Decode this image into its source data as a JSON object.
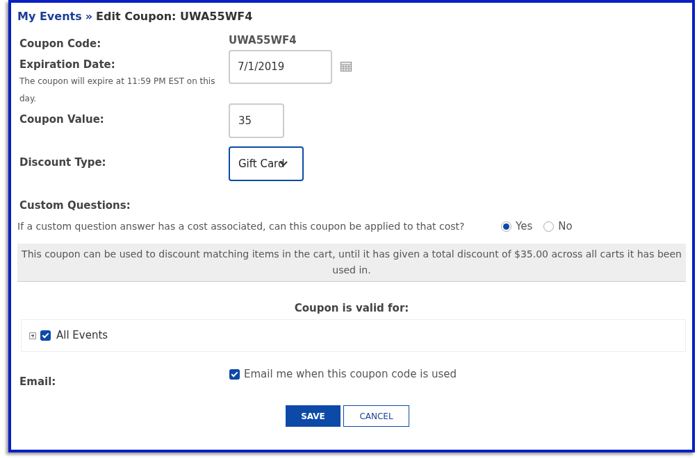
{
  "breadcrumb": {
    "link": "My Events",
    "separator": "»",
    "title": "Edit Coupon: UWA55WF4"
  },
  "coupon_code": {
    "label": "Coupon Code:",
    "value": "UWA55WF4"
  },
  "expiration": {
    "label": "Expiration Date:",
    "note": "The coupon will expire at 11:59 PM EST on this day.",
    "value": "7/1/2019"
  },
  "coupon_value": {
    "label": "Coupon Value:",
    "value": "35"
  },
  "discount_type": {
    "label": "Discount Type:",
    "value": "Gift Card"
  },
  "custom_questions": {
    "label": "Custom Questions:",
    "question": "If a custom question answer has a cost associated, can this coupon be applied to that cost?",
    "options": [
      {
        "label": "Yes",
        "selected": true
      },
      {
        "label": "No",
        "selected": false
      }
    ]
  },
  "notice": "This coupon can be used to discount matching items in the cart, until it has given a total discount of $35.00 across all carts it has been used in.",
  "valid_for": {
    "heading": "Coupon is valid for:",
    "items": [
      {
        "label": "All Events",
        "checked": true,
        "expanded": false
      }
    ]
  },
  "email": {
    "label": "Email:",
    "option": {
      "label": "Email me when this coupon code is used",
      "checked": true
    }
  },
  "buttons": [
    {
      "label": "SAVE",
      "kind": "primary"
    },
    {
      "label": "CANCEL",
      "kind": "secondary"
    }
  ]
}
